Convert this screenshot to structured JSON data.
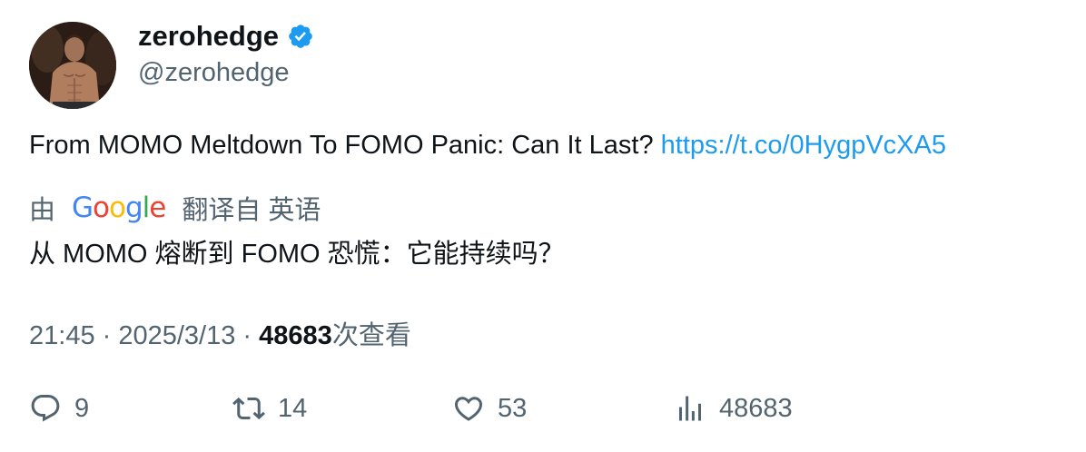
{
  "author": {
    "display_name": "zerohedge",
    "handle": "@zerohedge",
    "verified": true,
    "avatar_icon": "avatar-photo"
  },
  "tweet": {
    "text": "From MOMO Meltdown To FOMO Panic: Can It Last? ",
    "link": "https://t.co/0HygpVcXA5"
  },
  "translation": {
    "prefix": "由",
    "provider": "Google",
    "suffix": "翻译自 英语",
    "text": "从 MOMO 熔断到 FOMO 恐慌：它能持续吗？"
  },
  "meta": {
    "time": "21:45",
    "separator": " · ",
    "date": "2025/3/13",
    "views_count": "48683",
    "views_label": "次查看"
  },
  "actions": {
    "replies": "9",
    "retweets": "14",
    "likes": "53",
    "views": "48683"
  },
  "colors": {
    "link": "#1d9bf0",
    "secondary_text": "#536471",
    "primary_text": "#0f1419",
    "verified_badge": "#1d9bf0",
    "google_blue": "#4285F4",
    "google_red": "#EA4335",
    "google_yellow": "#FBBC05",
    "google_green": "#34A853"
  }
}
